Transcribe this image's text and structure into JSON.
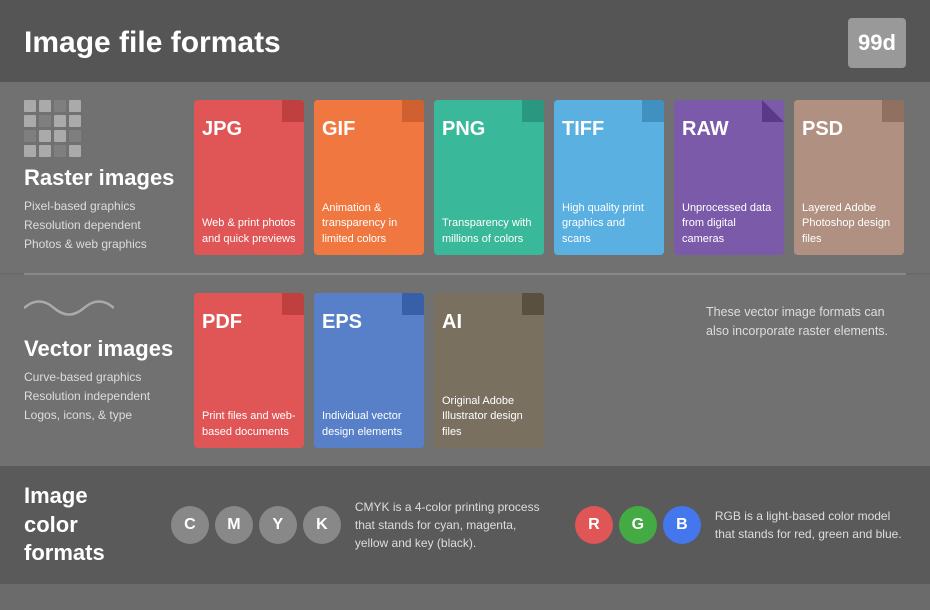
{
  "header": {
    "title": "Image file formats",
    "logo": "99d"
  },
  "raster": {
    "title": "Raster images",
    "desc_lines": [
      "Pixel-based graphics",
      "Resolution dependent",
      "Photos & web graphics"
    ],
    "cards": [
      {
        "id": "jpg",
        "label": "JPG",
        "color": "jpg",
        "desc": "Web & print photos and quick previews"
      },
      {
        "id": "gif",
        "label": "GIF",
        "color": "gif",
        "desc": "Animation & transparency in limited colors"
      },
      {
        "id": "png",
        "label": "PNG",
        "color": "png",
        "desc": "Transparency with millions of colors"
      },
      {
        "id": "tiff",
        "label": "TIFF",
        "color": "tiff",
        "desc": "High quality print graphics and scans"
      },
      {
        "id": "raw",
        "label": "RAW",
        "color": "raw",
        "desc": "Unprocessed data from digital cameras"
      },
      {
        "id": "psd",
        "label": "PSD",
        "color": "psd",
        "desc": "Layered Adobe Photoshop design files"
      }
    ]
  },
  "vector": {
    "title": "Vector images",
    "desc_lines": [
      "Curve-based graphics",
      "Resolution independent",
      "Logos, icons, & type"
    ],
    "cards": [
      {
        "id": "pdf",
        "label": "PDF",
        "color": "pdf",
        "desc": "Print files and web-based documents"
      },
      {
        "id": "eps",
        "label": "EPS",
        "color": "eps",
        "desc": "Individual vector design elements"
      },
      {
        "id": "ai",
        "label": "AI",
        "color": "ai",
        "desc": "Original Adobe Illustrator design files"
      }
    ],
    "note": "These vector image formats can also incorporate raster elements."
  },
  "colors": {
    "title": "Image color formats",
    "cmyk": {
      "circles": [
        {
          "letter": "C",
          "class": "c-circle"
        },
        {
          "letter": "M",
          "class": "m-circle"
        },
        {
          "letter": "Y",
          "class": "y-circle"
        },
        {
          "letter": "K",
          "class": "k-circle"
        }
      ],
      "desc": "CMYK is a 4-color printing process that stands for cyan, magenta, yellow and key (black)."
    },
    "rgb": {
      "circles": [
        {
          "letter": "R",
          "class": "r-circle"
        },
        {
          "letter": "G",
          "class": "g-circle"
        },
        {
          "letter": "B",
          "class": "b-circle"
        }
      ],
      "desc": "RGB is a light-based color model that stands for red, green and blue."
    }
  }
}
